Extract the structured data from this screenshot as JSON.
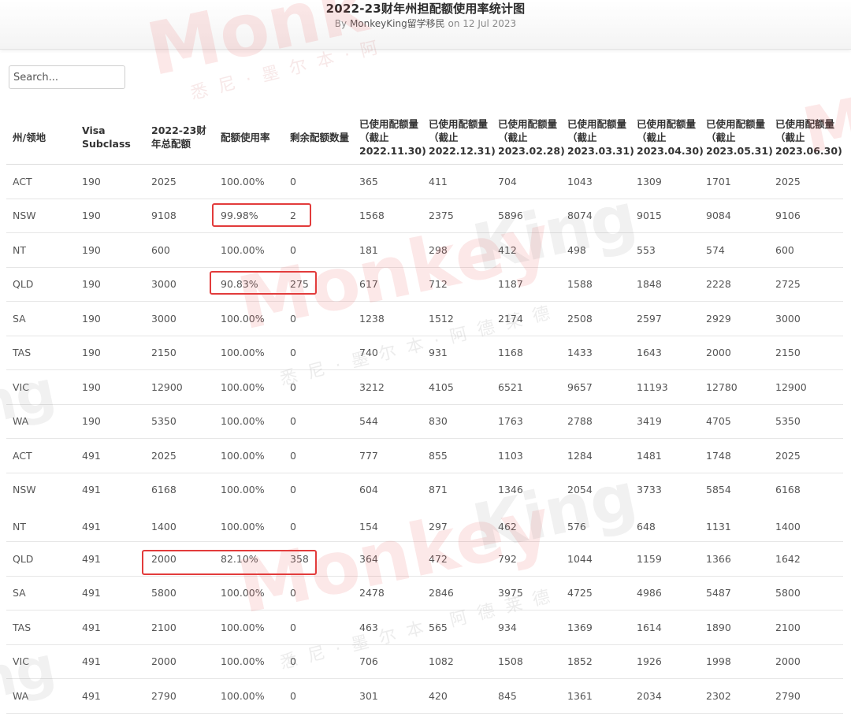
{
  "header": {
    "title": "2022-23财年州担配额使用率统计图",
    "byline_prefix": "By ",
    "author": "MonkeyKing留学移民",
    "byline_suffix": " on 12 Jul 2023"
  },
  "search": {
    "placeholder": "Search..."
  },
  "table": {
    "columns": [
      "州/领地",
      "Visa Subclass",
      "2022-23财年总配额",
      "配额使用率",
      "剩余配额数量",
      "已使用配额量（截止2022.11.30)",
      "已使用配额量（截止2022.12.31)",
      "已使用配额量（截止2023.02.28)",
      "已使用配额量（截止2023.03.31)",
      "已使用配额量（截止2023.04.30)",
      "已使用配额量（截止2023.05.31)",
      "已使用配额量（截止2023.06.30)"
    ],
    "rows": [
      [
        "ACT",
        "190",
        "2025",
        "100.00%",
        "0",
        "365",
        "411",
        "704",
        "1043",
        "1309",
        "1701",
        "2025"
      ],
      [
        "NSW",
        "190",
        "9108",
        "99.98%",
        "2",
        "1568",
        "2375",
        "5896",
        "8074",
        "9015",
        "9084",
        "9106"
      ],
      [
        "NT",
        "190",
        "600",
        "100.00%",
        "0",
        "181",
        "298",
        "412",
        "498",
        "553",
        "574",
        "600"
      ],
      [
        "QLD",
        "190",
        "3000",
        "90.83%",
        "275",
        "617",
        "712",
        "1187",
        "1588",
        "1848",
        "2228",
        "2725"
      ],
      [
        "SA",
        "190",
        "3000",
        "100.00%",
        "0",
        "1238",
        "1512",
        "2174",
        "2508",
        "2597",
        "2929",
        "3000"
      ],
      [
        "TAS",
        "190",
        "2150",
        "100.00%",
        "0",
        "740",
        "931",
        "1168",
        "1433",
        "1643",
        "2000",
        "2150"
      ],
      [
        "VIC",
        "190",
        "12900",
        "100.00%",
        "0",
        "3212",
        "4105",
        "6521",
        "9657",
        "11193",
        "12780",
        "12900"
      ],
      [
        "WA",
        "190",
        "5350",
        "100.00%",
        "0",
        "544",
        "830",
        "1763",
        "2788",
        "3419",
        "4705",
        "5350"
      ],
      [
        "ACT",
        "491",
        "2025",
        "100.00%",
        "0",
        "777",
        "855",
        "1103",
        "1284",
        "1481",
        "1748",
        "2025"
      ],
      [
        "NSW",
        "491",
        "6168",
        "100.00%",
        "0",
        "604",
        "871",
        "1346",
        "2054",
        "3733",
        "5854",
        "6168"
      ],
      [
        "NT",
        "491",
        "1400",
        "100.00%",
        "0",
        "154",
        "297",
        "462",
        "576",
        "648",
        "1131",
        "1400"
      ],
      [
        "QLD",
        "491",
        "2000",
        "82.10%",
        "358",
        "364",
        "472",
        "792",
        "1044",
        "1159",
        "1366",
        "1642"
      ],
      [
        "SA",
        "491",
        "5800",
        "100.00%",
        "0",
        "2478",
        "2846",
        "3975",
        "4725",
        "4986",
        "5487",
        "5800"
      ],
      [
        "TAS",
        "491",
        "2100",
        "100.00%",
        "0",
        "463",
        "565",
        "934",
        "1369",
        "1614",
        "1890",
        "2100"
      ],
      [
        "VIC",
        "491",
        "2000",
        "100.00%",
        "0",
        "706",
        "1082",
        "1508",
        "1852",
        "1926",
        "1998",
        "2000"
      ],
      [
        "WA",
        "491",
        "2790",
        "100.00%",
        "0",
        "301",
        "420",
        "845",
        "1361",
        "2034",
        "2302",
        "2790"
      ]
    ]
  },
  "colors": {
    "highlight": "#e23b3b",
    "watermark_red": "#e85050"
  }
}
